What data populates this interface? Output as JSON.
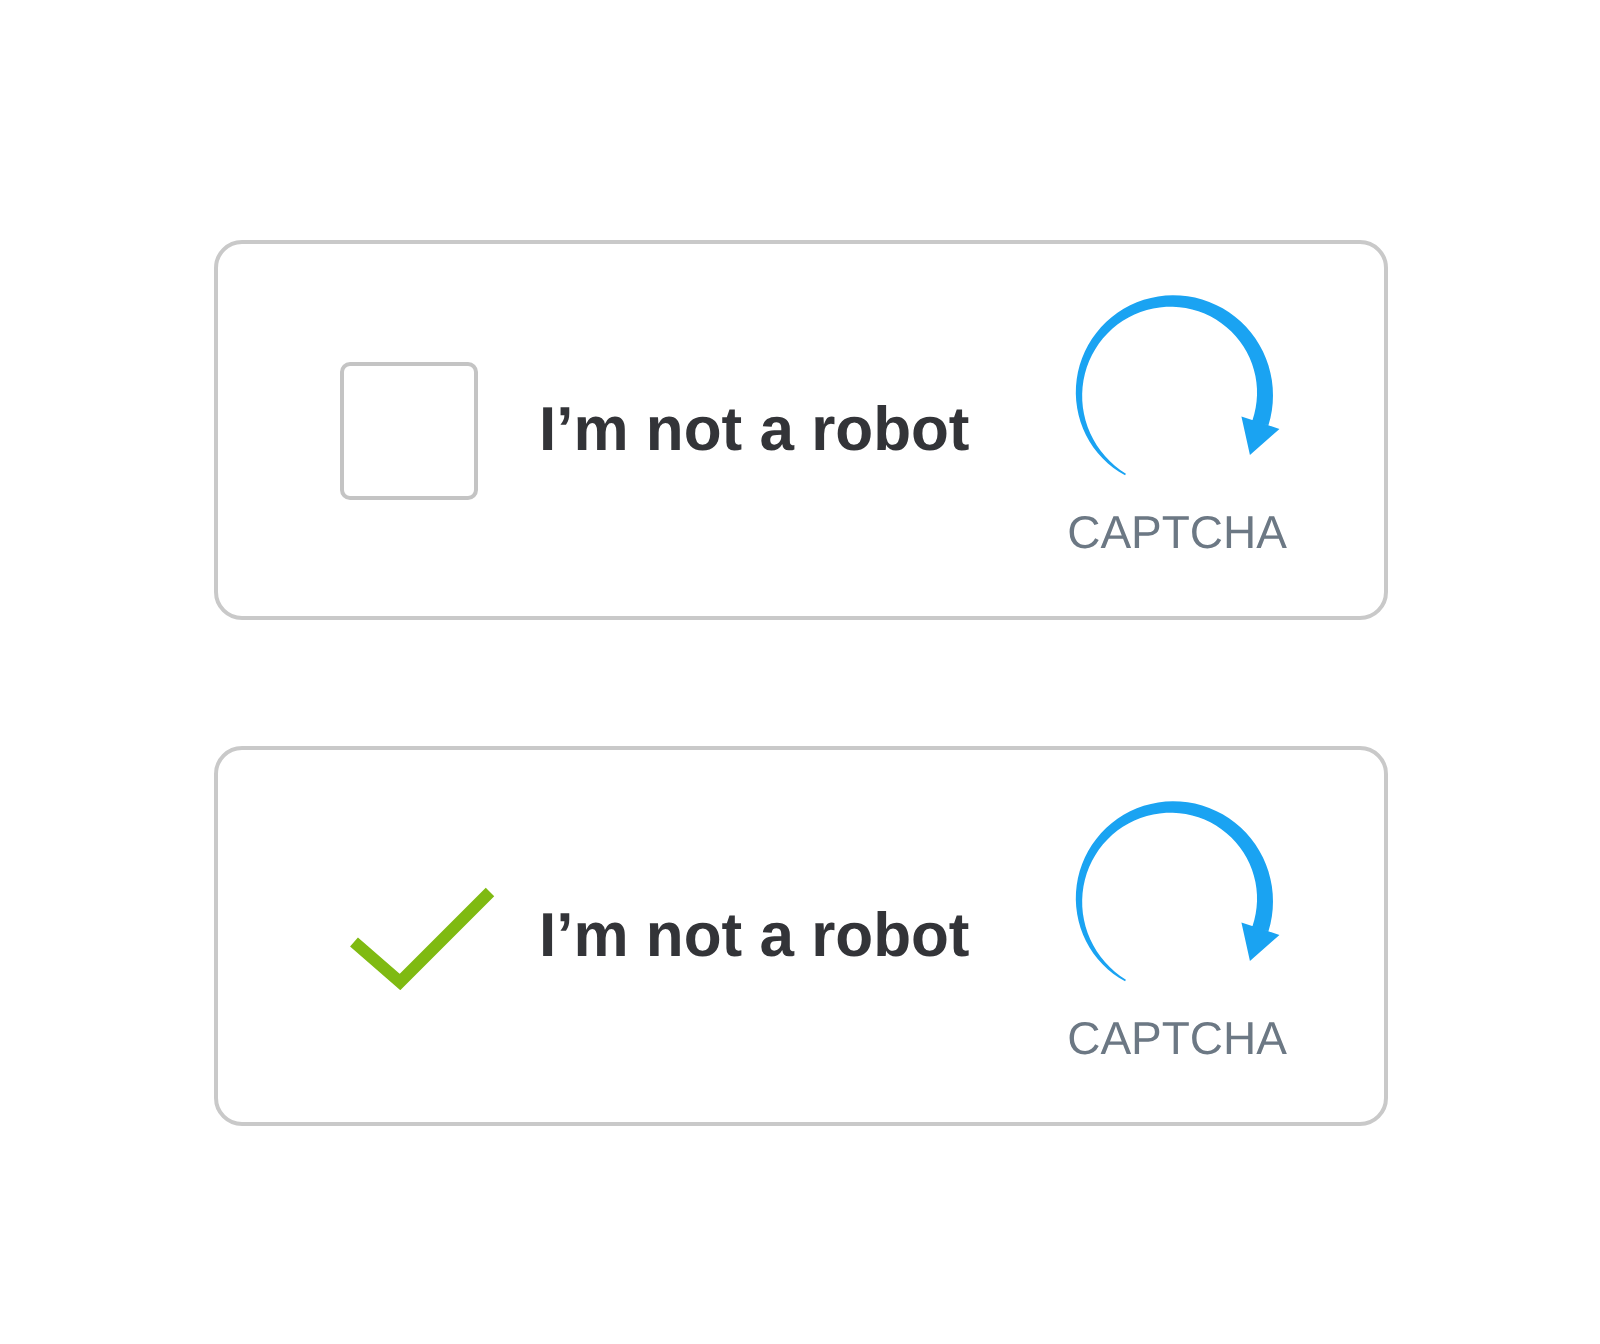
{
  "captcha_widgets": [
    {
      "checked": false,
      "label": "I’m not a robot",
      "caption": "CAPTCHA"
    },
    {
      "checked": true,
      "label": "I’m not a robot",
      "caption": "CAPTCHA"
    }
  ]
}
